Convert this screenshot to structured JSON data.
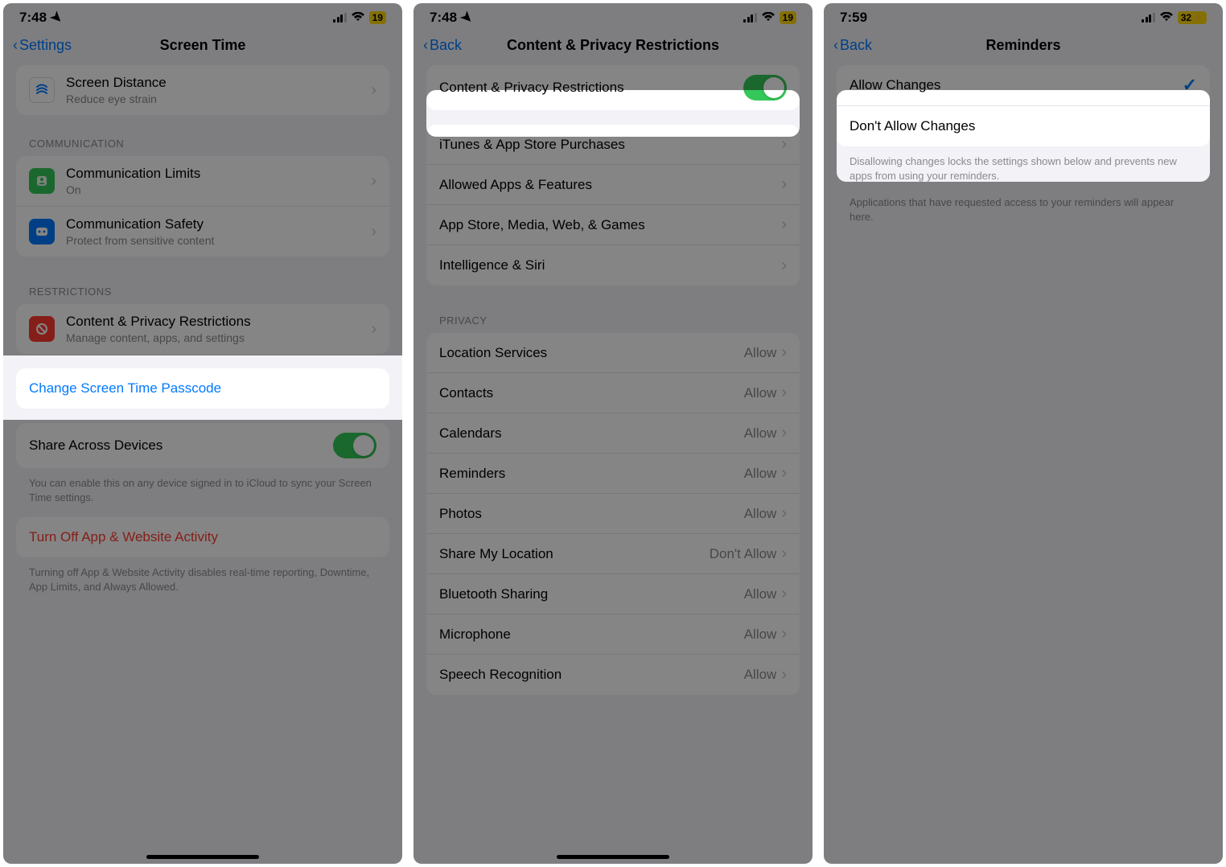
{
  "phone1": {
    "time": "7:48",
    "battery": "19",
    "back": "Settings",
    "title": "Screen Time",
    "screen_distance": {
      "title": "Screen Distance",
      "sub": "Reduce eye strain"
    },
    "section_comm": "COMMUNICATION",
    "comm_limits": {
      "title": "Communication Limits",
      "sub": "On"
    },
    "comm_safety": {
      "title": "Communication Safety",
      "sub": "Protect from sensitive content"
    },
    "section_restrict": "RESTRICTIONS",
    "cpr": {
      "title": "Content & Privacy Restrictions",
      "sub": "Manage content, apps, and settings"
    },
    "change_passcode": "Change Screen Time Passcode",
    "share_devices": "Share Across Devices",
    "share_footer": "You can enable this on any device signed in to iCloud to sync your Screen Time settings.",
    "turn_off": "Turn Off App & Website Activity",
    "turn_off_footer": "Turning off App & Website Activity disables real-time reporting, Downtime, App Limits, and Always Allowed."
  },
  "phone2": {
    "time": "7:48",
    "battery": "19",
    "back": "Back",
    "title": "Content & Privacy Restrictions",
    "toggle_label": "Content & Privacy Restrictions",
    "items_top": [
      "iTunes & App Store Purchases",
      "Allowed Apps & Features",
      "App Store, Media, Web, & Games",
      "Intelligence & Siri"
    ],
    "section_privacy": "PRIVACY",
    "privacy_items": [
      {
        "label": "Location Services",
        "value": "Allow"
      },
      {
        "label": "Contacts",
        "value": "Allow"
      },
      {
        "label": "Calendars",
        "value": "Allow"
      },
      {
        "label": "Reminders",
        "value": "Allow"
      },
      {
        "label": "Photos",
        "value": "Allow"
      },
      {
        "label": "Share My Location",
        "value": "Don't Allow"
      },
      {
        "label": "Bluetooth Sharing",
        "value": "Allow"
      },
      {
        "label": "Microphone",
        "value": "Allow"
      },
      {
        "label": "Speech Recognition",
        "value": "Allow"
      }
    ]
  },
  "phone3": {
    "time": "7:59",
    "battery": "32",
    "back": "Back",
    "title": "Reminders",
    "allow": "Allow Changes",
    "dont_allow": "Don't Allow Changes",
    "footer1": "Disallowing changes locks the settings shown below and prevents new apps from using your reminders.",
    "footer2": "Applications that have requested access to your reminders will appear here."
  }
}
